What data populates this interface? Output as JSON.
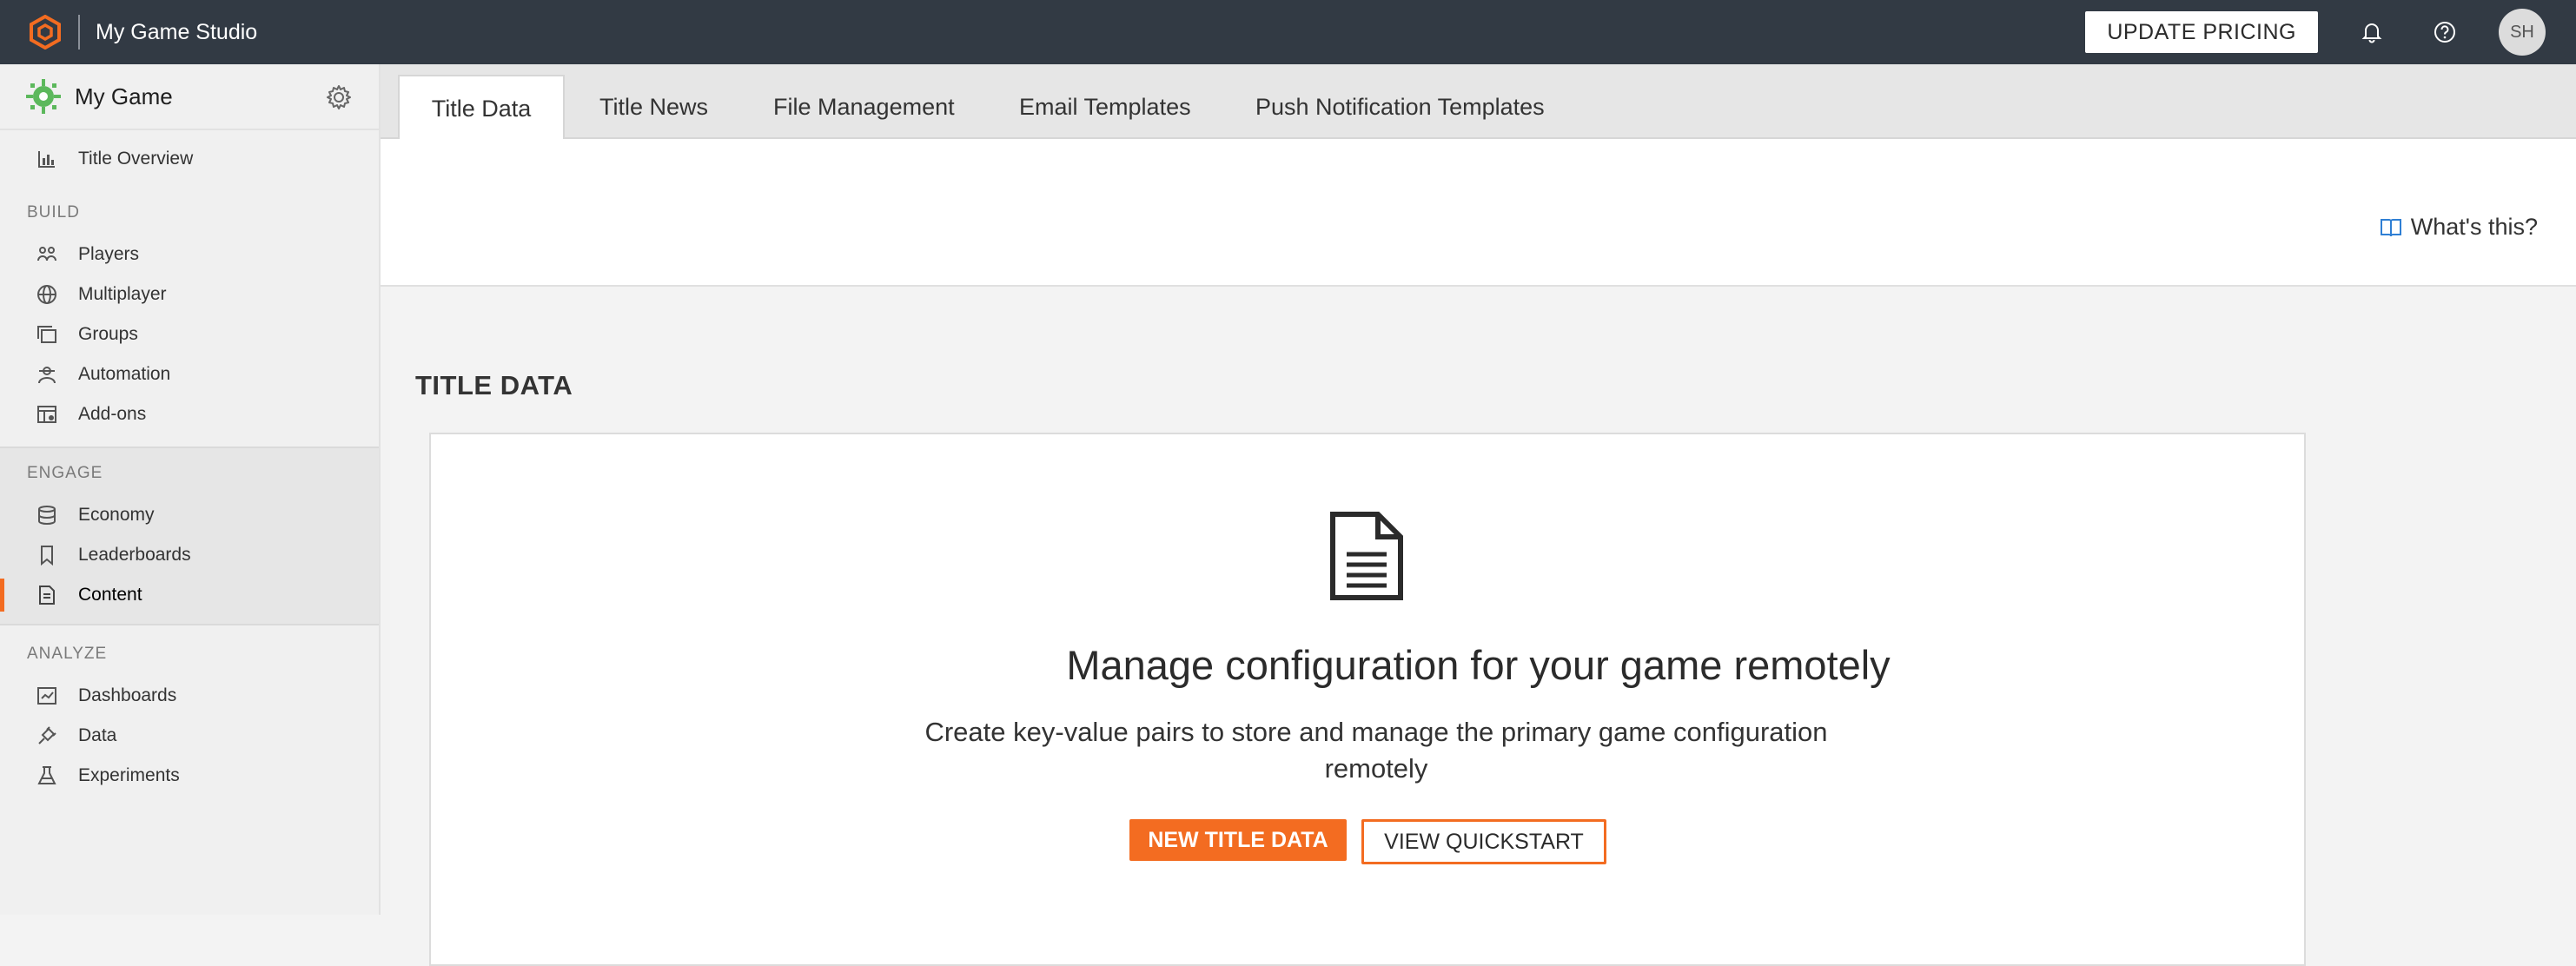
{
  "topbar": {
    "studio_name": "My Game Studio",
    "update_pricing_label": "UPDATE PRICING",
    "avatar_initials": "SH",
    "brand_color": "#f36c21",
    "background_color": "#323a44"
  },
  "sidebar": {
    "game_name": "My Game",
    "overview": {
      "label": "Title Overview",
      "icon": "bar-chart-icon"
    },
    "sections": [
      {
        "label": "BUILD",
        "items": [
          {
            "label": "Players",
            "icon": "players-icon"
          },
          {
            "label": "Multiplayer",
            "icon": "globe-icon"
          },
          {
            "label": "Groups",
            "icon": "groups-icon"
          },
          {
            "label": "Automation",
            "icon": "automation-icon"
          },
          {
            "label": "Add-ons",
            "icon": "addons-icon"
          }
        ]
      },
      {
        "label": "ENGAGE",
        "items": [
          {
            "label": "Economy",
            "icon": "database-icon"
          },
          {
            "label": "Leaderboards",
            "icon": "bookmark-icon"
          },
          {
            "label": "Content",
            "icon": "document-icon",
            "active": true
          }
        ]
      },
      {
        "label": "ANALYZE",
        "items": [
          {
            "label": "Dashboards",
            "icon": "dashboard-icon"
          },
          {
            "label": "Data",
            "icon": "plug-icon"
          },
          {
            "label": "Experiments",
            "icon": "flask-icon"
          }
        ]
      }
    ]
  },
  "tabs": [
    {
      "label": "Title Data",
      "active": true
    },
    {
      "label": "Title News"
    },
    {
      "label": "File Management"
    },
    {
      "label": "Email Templates"
    },
    {
      "label": "Push Notification Templates"
    }
  ],
  "whats_this_label": "What's this?",
  "content": {
    "section_title": "TITLE DATA",
    "headline": "Manage configuration for your game remotely",
    "subtext": "Create key-value pairs to store and manage the primary game configuration remotely",
    "primary_button": "NEW TITLE DATA",
    "secondary_button": "VIEW QUICKSTART",
    "accent_color": "#f36c21"
  }
}
